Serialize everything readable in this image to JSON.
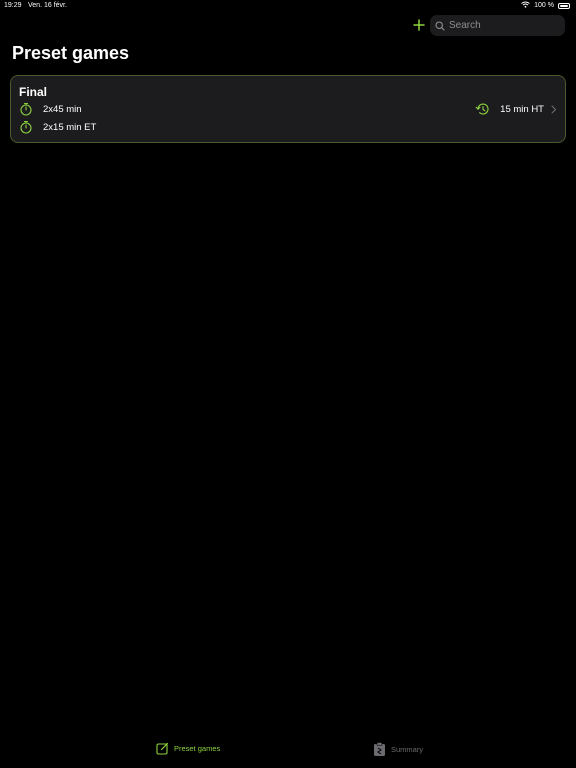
{
  "status_bar": {
    "time": "19:29",
    "date": "Ven. 16 févr.",
    "battery": "100 %"
  },
  "nav": {
    "search_placeholder": "Search"
  },
  "page": {
    "title": "Preset games"
  },
  "games": [
    {
      "name": "Final",
      "periods": "2x45 min",
      "extra_time": "2x15 min ET",
      "half_time": "15 min HT"
    }
  ],
  "tabs": [
    {
      "label": "Preset games",
      "selected": true
    },
    {
      "label": "Summary",
      "selected": false
    }
  ],
  "colors": {
    "accent": "#8ed43f",
    "background": "#000000",
    "card": "#1c1c1e",
    "inactive": "#6b6b70"
  }
}
